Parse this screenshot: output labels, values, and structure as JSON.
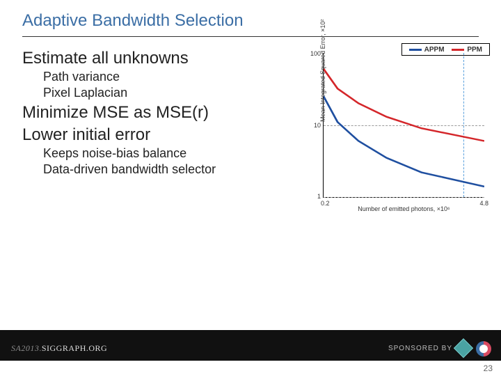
{
  "title": "Adaptive Bandwidth Selection",
  "bullets": {
    "b1": "Estimate all unknowns",
    "b1a": "Path variance",
    "b1b": "Pixel Laplacian",
    "b2": "Minimize MSE as MSE(r)",
    "b3": "Lower initial error",
    "b3a": "Keeps noise-bias balance",
    "b3b": "Data-driven bandwidth selector"
  },
  "footer": {
    "sa": "SA2013",
    "dot": ".",
    "sig": "SIGGRAPH.ORG",
    "sponsored": "SPONSORED BY",
    "page": "23"
  },
  "chart_data": {
    "type": "line",
    "title": "",
    "xlabel": "Number of emitted photons, ×10⁶",
    "ylabel": "Mean Integrated Squared Error, ×10²",
    "x_ticks": [
      "0.2",
      "4.8"
    ],
    "y_ticks": [
      "1",
      "10",
      "100"
    ],
    "xlim": [
      0.2,
      4.8
    ],
    "ylim_log": [
      1,
      100
    ],
    "vguide_x": 4.2,
    "series": [
      {
        "name": "APPM",
        "color": "#1f4fa0",
        "x": [
          0.2,
          0.6,
          1.2,
          2.0,
          3.0,
          4.8
        ],
        "y": [
          25,
          11,
          6,
          3.5,
          2.2,
          1.4
        ]
      },
      {
        "name": "PPM",
        "color": "#d4262a",
        "x": [
          0.2,
          0.6,
          1.2,
          2.0,
          3.0,
          4.8
        ],
        "y": [
          60,
          32,
          20,
          13,
          9,
          6
        ]
      }
    ]
  }
}
